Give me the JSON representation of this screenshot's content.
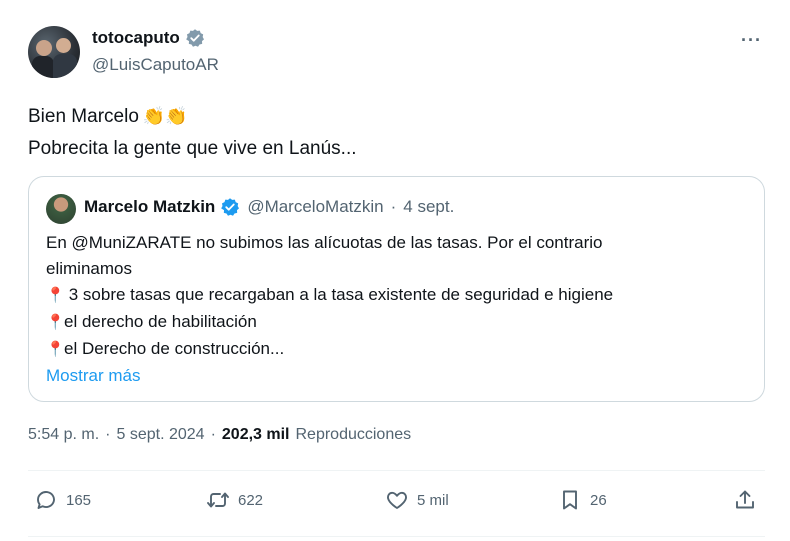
{
  "author": {
    "display_name": "totocaputo",
    "handle": "@LuisCaputoAR",
    "avatar_icon": "avatar-icon",
    "verified_icon": "verified-badge-icon"
  },
  "more_icon": "more-options-icon",
  "more_label": "···",
  "tweet": {
    "line1": "Bien Marcelo",
    "clap_emoji": "👏👏",
    "line2": "Pobrecita la gente que vive en Lanús..."
  },
  "quote": {
    "display_name": "Marcelo Matzkin",
    "handle": "@MarceloMatzkin",
    "separator": "·",
    "date": "4 sept.",
    "lines": [
      "En @MuniZARATE no subimos las alícuotas de las tasas. Por el contrario",
      "eliminamos",
      "3 sobre tasas que recargaban a la tasa existente de seguridad e higiene",
      "el derecho de habilitación",
      "el Derecho de construcción..."
    ],
    "pin_emoji": "📍",
    "show_more": "Mostrar más"
  },
  "meta": {
    "time": "5:54 p. m.",
    "sep1": "·",
    "date": "5 sept. 2024",
    "sep2": "·",
    "views": "202,3 mil",
    "views_label": "Reproducciones"
  },
  "actions": {
    "replies": "165",
    "reposts": "622",
    "likes": "5 mil",
    "bookmarks": "26"
  },
  "colors": {
    "accent": "#1d9bf0",
    "text": "#0f1419",
    "secondary": "#536471",
    "border": "#cfd9de"
  }
}
